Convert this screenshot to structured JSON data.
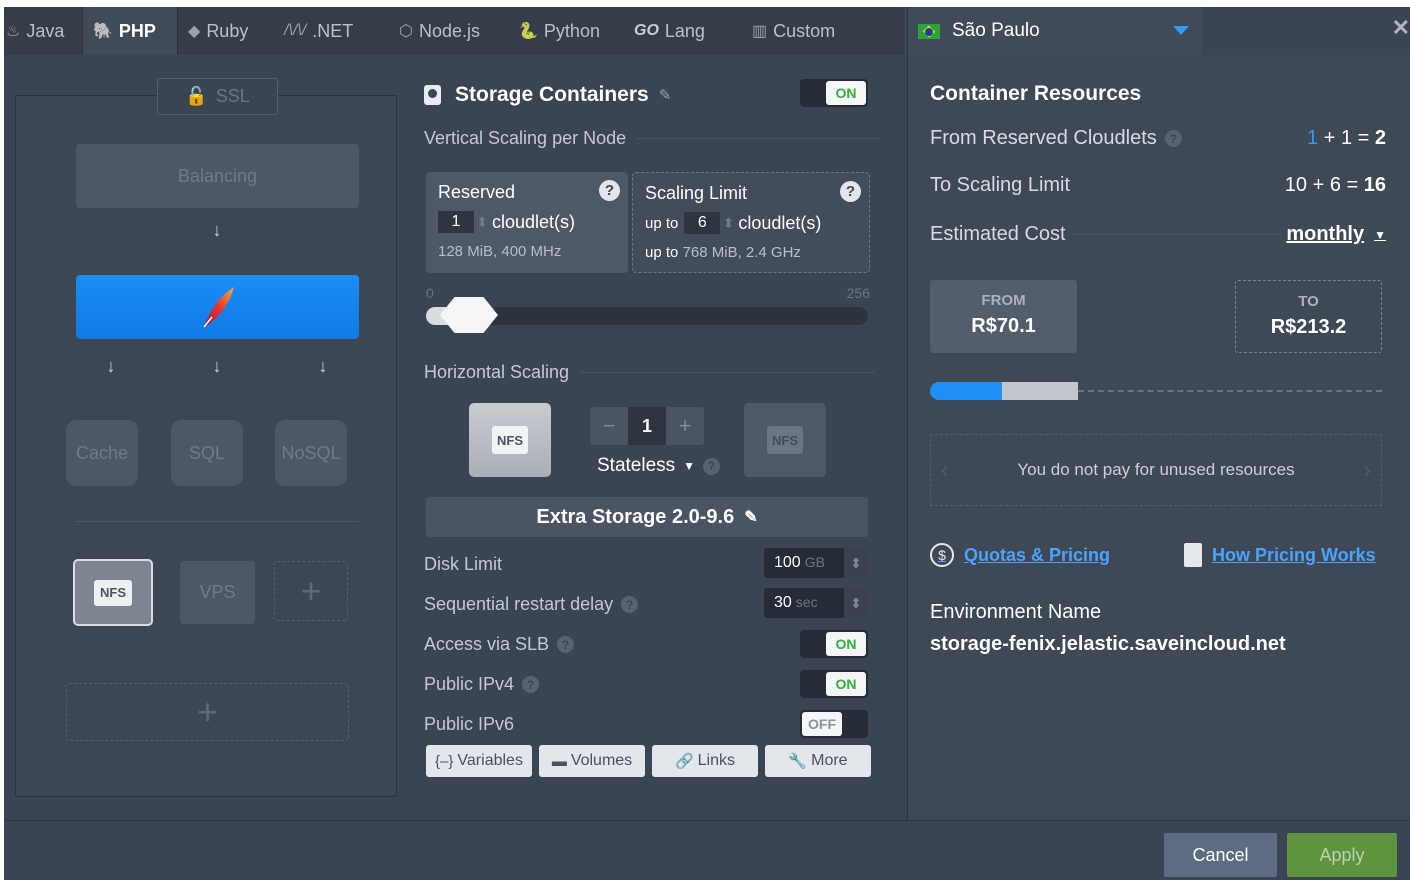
{
  "tabs": [
    {
      "label": "Java",
      "icon": "java-icon"
    },
    {
      "label": "PHP",
      "icon": "php-icon"
    },
    {
      "label": "Ruby",
      "icon": "ruby-icon"
    },
    {
      "label": ".NET",
      "icon": "dotnet-icon"
    },
    {
      "label": "Node.js",
      "icon": "nodejs-icon"
    },
    {
      "label": "Python",
      "icon": "python-icon"
    },
    {
      "label": "Lang",
      "prefix": "GO",
      "icon": "go-icon"
    },
    {
      "label": "Custom",
      "icon": "custom-icon"
    }
  ],
  "active_tab": "PHP",
  "region": {
    "name": "São Paulo"
  },
  "topology": {
    "ssl_label": "SSL",
    "balancing_label": "Balancing",
    "cache_label": "Cache",
    "sql_label": "SQL",
    "nosql_label": "NoSQL",
    "nfs_label": "NFS",
    "vps_label": "VPS",
    "add_symbol": "+"
  },
  "storage": {
    "title": "Storage Containers",
    "toggle": "ON",
    "vertical_label": "Vertical Scaling per Node",
    "reserved": {
      "title": "Reserved",
      "value": "1",
      "unit": "cloudlet(s)",
      "info": "128 MiB, 400 MHz"
    },
    "limit": {
      "title": "Scaling Limit",
      "prefix": "up to",
      "value": "6",
      "unit": "cloudlet(s)",
      "info_prefix": "up to",
      "info": "768 MiB, 2.4 GHz"
    },
    "slider": {
      "min": "0",
      "max": "256",
      "reserved": 1,
      "limit": 6
    },
    "horizontal_label": "Horizontal Scaling",
    "nodes_count": "1",
    "minus": "−",
    "plus": "+",
    "stateless_label": "Stateless",
    "nfs_label": "NFS",
    "extra_storage": "Extra Storage 2.0-9.6",
    "disk_limit": {
      "label": "Disk Limit",
      "value": "100",
      "unit": "GB"
    },
    "restart_delay": {
      "label": "Sequential restart delay",
      "value": "30",
      "unit": "sec"
    },
    "access_slb": {
      "label": "Access via SLB",
      "state": "ON"
    },
    "ipv4": {
      "label": "Public IPv4",
      "state": "ON"
    },
    "ipv6": {
      "label": "Public IPv6",
      "state": "OFF"
    },
    "buttons": {
      "variables": "Variables",
      "volumes": "Volumes",
      "links": "Links",
      "more": "More"
    }
  },
  "resources": {
    "title": "Container Resources",
    "from_reserved": {
      "label": "From Reserved Cloudlets",
      "a": "1",
      "b": "1",
      "total": "2"
    },
    "to_limit": {
      "label": "To Scaling Limit",
      "a": "10",
      "b": "6",
      "total": "16"
    },
    "estimated": {
      "label": "Estimated Cost",
      "period": "monthly"
    },
    "from": {
      "label": "FROM",
      "value": "R$70.1"
    },
    "to": {
      "label": "TO",
      "value": "R$213.2"
    },
    "unused_text": "You do not pay for unused resources",
    "quotas_link": "Quotas & Pricing",
    "how_link": "How Pricing Works",
    "env_label": "Environment Name",
    "env_value": "storage-fenix.jelastic.saveincloud.net"
  },
  "footer": {
    "cancel": "Cancel",
    "apply": "Apply"
  },
  "colors": {
    "accent": "#1d8ff5",
    "on_green": "#31b03a",
    "apply": "#5e9440"
  }
}
